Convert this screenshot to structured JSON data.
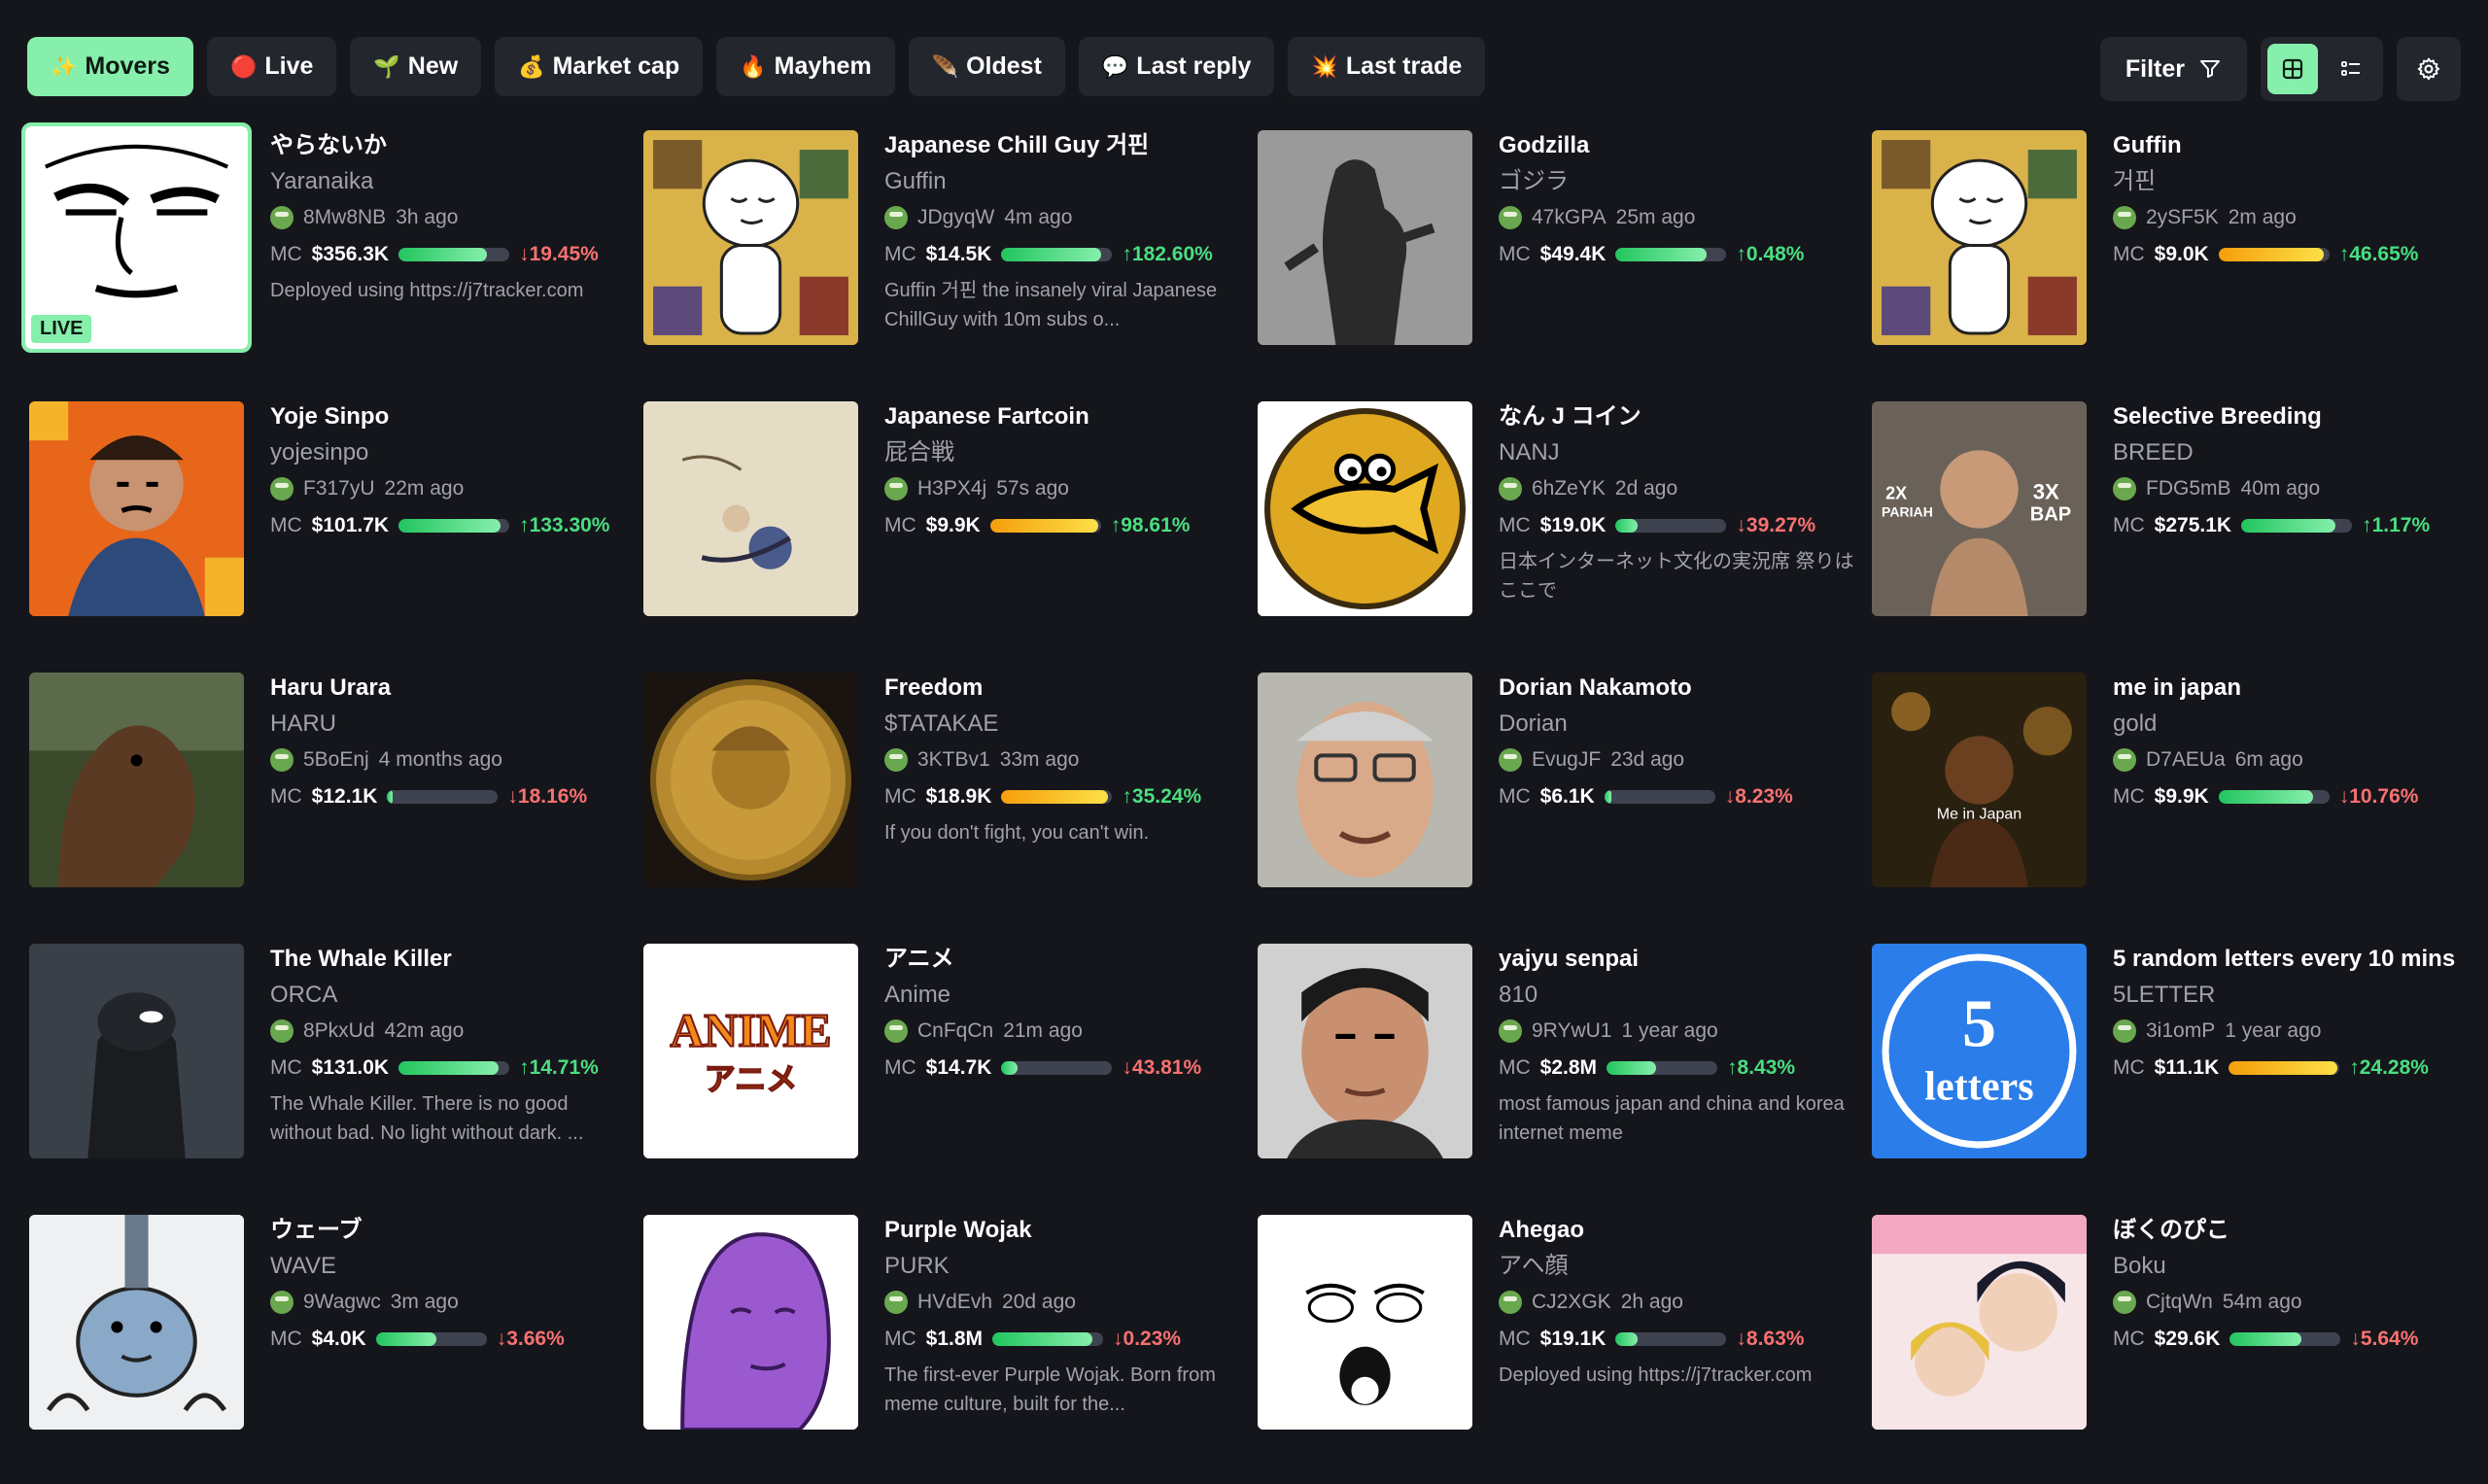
{
  "tabs": [
    {
      "label": "Movers",
      "icon": "✨",
      "active": true
    },
    {
      "label": "Live",
      "icon": "🔴",
      "active": false
    },
    {
      "label": "New",
      "icon": "🌱",
      "active": false
    },
    {
      "label": "Market cap",
      "icon": "💰",
      "active": false
    },
    {
      "label": "Mayhem",
      "icon": "🔥",
      "active": false
    },
    {
      "label": "Oldest",
      "icon": "🪶",
      "active": false
    },
    {
      "label": "Last reply",
      "icon": "💬",
      "active": false
    },
    {
      "label": "Last trade",
      "icon": "💥",
      "active": false
    }
  ],
  "controls": {
    "filter_label": "Filter",
    "view_mode": "grid"
  },
  "mc_label": "MC",
  "live_label": "LIVE",
  "cards": [
    {
      "name": "やらないか",
      "ticker": "Yaranaika",
      "creator": "8Mw8NB",
      "age": "3h ago",
      "mc": "$356.3K",
      "change": "19.45%",
      "dir": "down",
      "progress": 0.8,
      "desc": "Deployed using https://j7tracker.com",
      "live": true,
      "art": "face"
    },
    {
      "name": "Japanese Chill Guy 거핀",
      "ticker": "Guffin",
      "creator": "JDgyqW",
      "age": "4m ago",
      "mc": "$14.5K",
      "change": "182.60%",
      "dir": "up",
      "progress": 0.9,
      "desc": "Guffin 거핀 the insanely viral Japanese ChillGuy with 10m subs o...",
      "live": false,
      "art": "chill"
    },
    {
      "name": "Godzilla",
      "ticker": "ゴジラ",
      "creator": "47kGPA",
      "age": "25m ago",
      "mc": "$49.4K",
      "change": "0.48%",
      "dir": "up",
      "progress": 0.82,
      "desc": "",
      "live": false,
      "art": "godzilla"
    },
    {
      "name": "Guffin",
      "ticker": "거핀",
      "creator": "2ySF5K",
      "age": "2m ago",
      "mc": "$9.0K",
      "change": "46.65%",
      "dir": "up",
      "progress": 0.95,
      "gold": true,
      "desc": "",
      "live": false,
      "art": "chill"
    },
    {
      "name": "Yoje Sinpo",
      "ticker": "yojesinpo",
      "creator": "F317yU",
      "age": "22m ago",
      "mc": "$101.7K",
      "change": "133.30%",
      "dir": "up",
      "progress": 0.92,
      "desc": "",
      "live": false,
      "art": "yoje"
    },
    {
      "name": "Japanese Fartcoin",
      "ticker": "屁合戦",
      "creator": "H3PX4j",
      "age": "57s ago",
      "mc": "$9.9K",
      "change": "98.61%",
      "dir": "up",
      "progress": 0.98,
      "gold": true,
      "desc": "",
      "live": false,
      "art": "scroll"
    },
    {
      "name": "なん J コイン",
      "ticker": "NANJ",
      "creator": "6hZeYK",
      "age": "2d ago",
      "mc": "$19.0K",
      "change": "39.27%",
      "dir": "down",
      "progress": 0.2,
      "desc": "日本インターネット文化の実況席 祭りはここで",
      "live": false,
      "art": "nanj"
    },
    {
      "name": "Selective Breeding",
      "ticker": "BREED",
      "creator": "FDG5mB",
      "age": "40m ago",
      "mc": "$275.1K",
      "change": "1.17%",
      "dir": "up",
      "progress": 0.85,
      "desc": "",
      "live": false,
      "art": "breed"
    },
    {
      "name": "Haru Urara",
      "ticker": "HARU",
      "creator": "5BoEnj",
      "age": "4 months ago",
      "mc": "$12.1K",
      "change": "18.16%",
      "dir": "down",
      "progress": 0.05,
      "desc": "",
      "live": false,
      "art": "horse"
    },
    {
      "name": "Freedom",
      "ticker": "$TATAKAE",
      "creator": "3KTBv1",
      "age": "33m ago",
      "mc": "$18.9K",
      "change": "35.24%",
      "dir": "up",
      "progress": 0.96,
      "gold": true,
      "desc": "If you don't fight, you can't win.",
      "live": false,
      "art": "coin"
    },
    {
      "name": "Dorian Nakamoto",
      "ticker": "Dorian",
      "creator": "EvugJF",
      "age": "23d ago",
      "mc": "$6.1K",
      "change": "8.23%",
      "dir": "down",
      "progress": 0.06,
      "desc": "",
      "live": false,
      "art": "dorian"
    },
    {
      "name": "me in japan",
      "ticker": "gold",
      "creator": "D7AEUa",
      "age": "6m ago",
      "mc": "$9.9K",
      "change": "10.76%",
      "dir": "down",
      "progress": 0.85,
      "desc": "",
      "live": false,
      "art": "japan"
    },
    {
      "name": "The Whale Killer",
      "ticker": "ORCA",
      "creator": "8PkxUd",
      "age": "42m ago",
      "mc": "$131.0K",
      "change": "14.71%",
      "dir": "up",
      "progress": 0.9,
      "desc": "The Whale Killer. There is no good without bad. No light without dark. ...",
      "live": false,
      "art": "orca"
    },
    {
      "name": "アニメ",
      "ticker": "Anime",
      "creator": "CnFqCn",
      "age": "21m ago",
      "mc": "$14.7K",
      "change": "43.81%",
      "dir": "down",
      "progress": 0.15,
      "desc": "",
      "live": false,
      "art": "anime"
    },
    {
      "name": "yajyu senpai",
      "ticker": "810",
      "creator": "9RYwU1",
      "age": "1 year ago",
      "mc": "$2.8M",
      "change": "8.43%",
      "dir": "up",
      "progress": 0.45,
      "desc": "most famous japan and china and korea internet meme",
      "live": false,
      "art": "yajyu"
    },
    {
      "name": "5 random letters every 10 mins",
      "ticker": "5LETTER",
      "creator": "3i1omP",
      "age": "1 year ago",
      "mc": "$11.1K",
      "change": "24.28%",
      "dir": "up",
      "progress": 0.98,
      "gold": true,
      "desc": "",
      "live": false,
      "art": "letters"
    },
    {
      "name": "ウェーブ",
      "ticker": "WAVE",
      "creator": "9Wagwc",
      "age": "3m ago",
      "mc": "$4.0K",
      "change": "3.66%",
      "dir": "down",
      "progress": 0.55,
      "desc": "",
      "live": false,
      "art": "wave"
    },
    {
      "name": "Purple Wojak",
      "ticker": "PURK",
      "creator": "HVdEvh",
      "age": "20d ago",
      "mc": "$1.8M",
      "change": "0.23%",
      "dir": "down",
      "progress": 0.9,
      "desc": "The first-ever Purple Wojak. Born from meme culture, built for the...",
      "live": false,
      "art": "wojak"
    },
    {
      "name": "Ahegao",
      "ticker": "アヘ顔",
      "creator": "CJ2XGK",
      "age": "2h ago",
      "mc": "$19.1K",
      "change": "8.63%",
      "dir": "down",
      "progress": 0.2,
      "desc": "Deployed using https://j7tracker.com",
      "live": false,
      "art": "ahegao"
    },
    {
      "name": "ぼくのぴこ",
      "ticker": "Boku",
      "creator": "CjtqWn",
      "age": "54m ago",
      "mc": "$29.6K",
      "change": "5.64%",
      "dir": "down",
      "progress": 0.65,
      "desc": "",
      "live": false,
      "art": "boku"
    }
  ],
  "art_text": {
    "breed_2x": "2X",
    "breed_pariah": "PARIAH",
    "breed_3x": "3X",
    "breed_bap": "BAP",
    "japan": "Me in Japan",
    "anime_en": "ANIME",
    "anime_jp": "アニメ",
    "letters_num": "5",
    "letters_word": "letters"
  }
}
